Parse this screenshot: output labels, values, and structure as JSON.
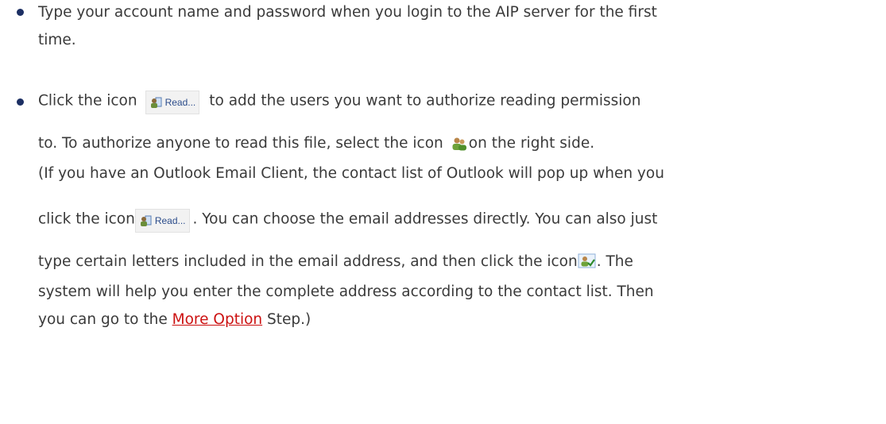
{
  "items": [
    {
      "lines": [
        "Type your account name and password when you login to the AIP server for the first",
        "time."
      ]
    },
    {
      "line1_before": "Click the icon",
      "read_label": "Read...",
      "line1_after": "to add the users you want to authorize reading permission",
      "line2_before": "to. To authorize anyone to read this file, select the icon",
      "line2_after": "on the right side.",
      "line3": "(If you have an Outlook Email Client, the contact list of Outlook will pop up when you",
      "line4_before": "click the icon",
      "line4_after": ". You can choose the email addresses directly. You can also just",
      "line5_before": "type certain letters included in the email address, and then click the icon",
      "line5_after": ". The",
      "line6": "system will help you enter the complete address according to the contact list. Then",
      "line7_before": "you can go to the",
      "link_text": "More Option",
      "line7_after": "Step.)"
    }
  ],
  "colors": {
    "text": "#3a3a3a",
    "bullet": "#1c2f63",
    "link": "#cc1111"
  },
  "icons": [
    "read-users-icon",
    "everyone-icon",
    "check-names-icon"
  ]
}
